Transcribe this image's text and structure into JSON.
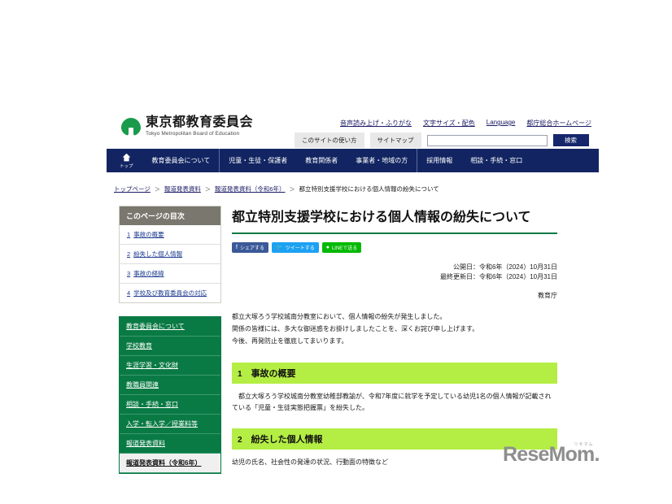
{
  "header": {
    "logo_jp": "東京都教育委員会",
    "logo_en": "Tokyo Metropolitan Board of Education",
    "util_links": [
      "音声読み上げ・ふりがな",
      "文字サイズ・配色",
      "Language",
      "都庁総合ホームページ"
    ],
    "how_to_use": "このサイトの使い方",
    "sitemap": "サイトマップ",
    "search_placeholder": "",
    "search_value": "",
    "search_button": "検索"
  },
  "gnav": {
    "home_label": "トップ",
    "items": [
      "教育委員会について",
      "児童・生徒・保護者",
      "教育関係者",
      "事業者・地域の方",
      "採用情報",
      "相談・手続・窓口"
    ]
  },
  "breadcrumb": {
    "items": [
      "トップページ",
      "報道発表資料",
      "報道発表資料（令和6年）"
    ],
    "current": "都立特別支援学校における個人情報の紛失について",
    "separator": "＞"
  },
  "sidebar": {
    "toc_title": "このページの目次",
    "toc_items": [
      {
        "num": "1",
        "label": "事故の概要"
      },
      {
        "num": "2",
        "label": "紛失した個人情報"
      },
      {
        "num": "3",
        "label": "事故の経緯"
      },
      {
        "num": "4",
        "label": "学校及び教育委員会の対応"
      }
    ],
    "menu_items": [
      {
        "label": "教育委員会について",
        "current": false
      },
      {
        "label": "学校教育",
        "current": false
      },
      {
        "label": "生涯学習・文化財",
        "current": false
      },
      {
        "label": "教職員関連",
        "current": false
      },
      {
        "label": "相談・手続・窓口",
        "current": false
      },
      {
        "label": "入学・転入学／授業料等",
        "current": false
      },
      {
        "label": "報道発表資料",
        "current": false
      },
      {
        "label": "報道発表資料（令和6年）",
        "current": true
      }
    ]
  },
  "main": {
    "title": "都立特別支援学校における個人情報の紛失について",
    "share": [
      {
        "label": "シェアする",
        "icon": "facebook-icon"
      },
      {
        "label": "ツイートする",
        "icon": "twitter-icon"
      },
      {
        "label": "LINEで送る",
        "icon": "line-icon"
      }
    ],
    "published": "公開日：令和6年（2024）10月31日",
    "updated": "最終更新日：令和6年（2024）10月31日",
    "department": "教育庁",
    "lead": [
      "都立大塚ろう学校城南分教室において、個人情報の紛失が発生しました。",
      "関係の皆様には、多大な御迷惑をお掛けしましたことを、深くお詫び申し上げます。",
      "今後、再発防止を徹底してまいります。"
    ],
    "sections": [
      {
        "num": "1",
        "heading": "事故の概要",
        "body": "都立大塚ろう学校城南分教室幼稚部教諭が、令和7年度に就学を予定している幼児1名の個人情報が記載されている「児童・生徒実態把握票」を紛失した。"
      },
      {
        "num": "2",
        "heading": "紛失した個人情報",
        "body": "幼児の氏名、社会性の発達の状況、行動面の特徴など"
      }
    ]
  },
  "watermark": {
    "text": "ReseMom",
    "kana": "リセマム",
    "dot": "."
  },
  "colors": {
    "nav_blue": "#122562",
    "brand_green": "#0a7a44",
    "section_green": "#b4ee44",
    "toc_header_gray": "#7a786e",
    "link_blue": "#1a3a8f"
  }
}
